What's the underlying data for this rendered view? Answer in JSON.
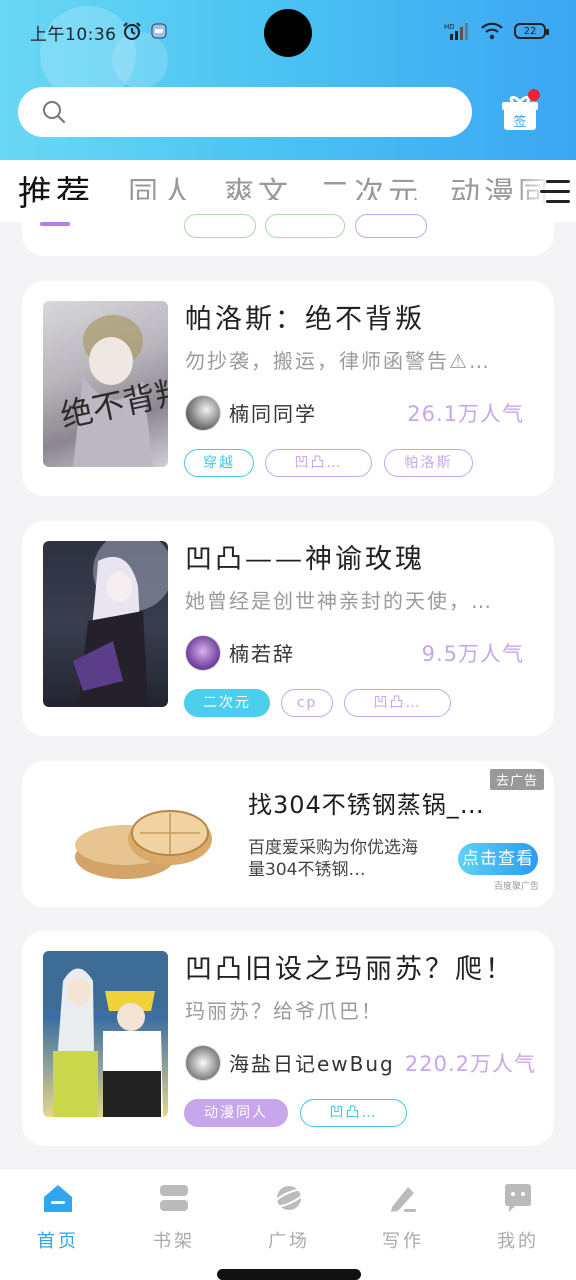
{
  "status_bar": {
    "time": "上午10:36",
    "battery": "22"
  },
  "search": {
    "placeholder": ""
  },
  "sign_button": {
    "label": "签"
  },
  "tabs": [
    {
      "label": "推荐",
      "active": true
    },
    {
      "label": "同人"
    },
    {
      "label": "爽文"
    },
    {
      "label": "二次元"
    },
    {
      "label": "动漫同"
    }
  ],
  "books": [
    {
      "title": "帕洛斯：绝不背叛",
      "description": "勿抄袭，搬运，律师函警告⚠…",
      "author": "楠同同学",
      "popularity": "26.1万人气",
      "cover_text": "绝不背叛",
      "tags": [
        {
          "label": "穿越",
          "color": "#3ec7e8",
          "filled": false
        },
        {
          "label": "凹凸…",
          "color": "#c7a6ec",
          "filled": false
        },
        {
          "label": "帕洛斯",
          "color": "#c7a6ec",
          "filled": false
        }
      ]
    },
    {
      "title": "凹凸——神谕玫瑰",
      "description": "她曾经是创世神亲封的天使，…",
      "author": "楠若辞",
      "popularity": "9.5万人气",
      "tags": [
        {
          "label": "二次元",
          "color": "#4ccfee",
          "filled": true
        },
        {
          "label": "cp",
          "color": "#c7a6ec",
          "filled": false
        },
        {
          "label": "凹凸…",
          "color": "#c7a6ec",
          "filled": false
        }
      ]
    },
    {
      "title": "凹凸旧设之玛丽苏？爬！",
      "description": "玛丽苏？给爷爪巴！",
      "author": "海盐日记ewBug",
      "popularity": "220.2万人气",
      "tags": [
        {
          "label": "动漫同人",
          "color": "#c7a6ec",
          "filled": true
        },
        {
          "label": "凹凸…",
          "color": "#3ec7e8",
          "filled": false
        }
      ]
    }
  ],
  "ad": {
    "title": "找304不锈钢蒸锅_…",
    "description": "百度爱采购为你优选海量304不锈钢…",
    "badge": "去广告",
    "button": "点击查看",
    "source": "百度聚广告"
  },
  "bottom_nav": [
    {
      "label": "首页",
      "icon": "home-icon",
      "active": true
    },
    {
      "label": "书架",
      "icon": "bookshelf-icon"
    },
    {
      "label": "广场",
      "icon": "planet-icon"
    },
    {
      "label": "写作",
      "icon": "pen-icon"
    },
    {
      "label": "我的",
      "icon": "profile-chat-icon"
    }
  ],
  "colors": {
    "accent": "#2ea7f0",
    "popularity": "#c7a6ec",
    "header_start": "#6ad8f4",
    "header_end": "#3ba6f3"
  }
}
